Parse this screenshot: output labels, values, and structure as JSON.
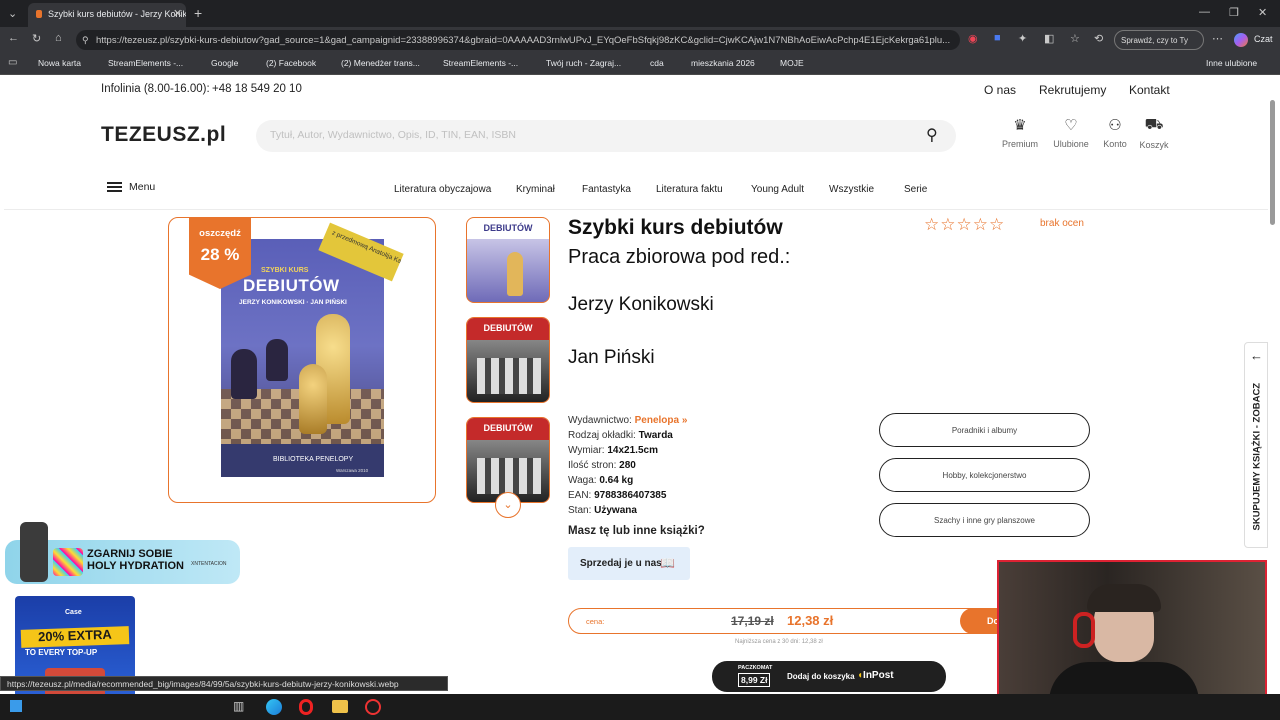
{
  "browser": {
    "tab_title": "Szybki kurs debiutów - Jerzy Konik...",
    "url": "https://tezeusz.pl/szybki-kurs-debiutow?gad_source=1&gad_campaignid=23388996374&gbraid=0AAAAAD3rnlwUPvJ_EYqOeFbSfqkj98zKC&gclid=CjwKCAjw1N7NBhAoEiwAcPchp4E1EjcKekrga61plu...",
    "profile_label": "Sprawdź, czy to Ty",
    "chat_label": "Czat",
    "bookmarks": [
      "Nowa karta",
      "StreamElements -...",
      "Google",
      "(2) Facebook",
      "(2) Menedżer trans...",
      "StreamElements -...",
      "Twój ruch - Zagraj...",
      "cda",
      "mieszkania 2026",
      "MOJE"
    ],
    "other_bookmarks": "Inne ulubione"
  },
  "topbar": {
    "hotline_label": "Infolinia (8.00-16.00):",
    "hotline_phone": "+48 18 549 20 10",
    "links": [
      "O nas",
      "Rekrutujemy",
      "Kontakt"
    ]
  },
  "header": {
    "logo": "TEZEUSZ.pl",
    "search_placeholder": "Tytuł, Autor, Wydawnictwo, Opis, ID, TIN, EAN, ISBN",
    "icons": [
      "Premium",
      "Ulubione",
      "Konto",
      "Koszyk"
    ]
  },
  "nav": {
    "menu_label": "Menu",
    "items": [
      "Literatura obyczajowa",
      "Kryminał",
      "Fantastyka",
      "Literatura faktu",
      "Young Adult",
      "Wszystkie",
      "Serie"
    ]
  },
  "product": {
    "discount_label": "oszczędź",
    "discount_value": "28 %",
    "cover_title": "DEBIUTÓW",
    "cover_small": "SZYBKI KURS",
    "cover_authors": "JERZY KONIKOWSKI · JAN PIŃSKI",
    "cover_ribbon": "z przedmową Anatolija Karpowa",
    "cover_series": "BIBLIOTEKA PENELOPY",
    "cover_place": "Warszawa 2010",
    "thumb_titles": [
      "DEBIUTÓW",
      "DEBIUTÓW",
      "DEBIUTÓW"
    ],
    "title": "Szybki kurs debiutów",
    "subtitle": "Praca zbiorowa pod red.:",
    "authors": [
      "Jerzy Konikowski",
      "Jan Piński"
    ],
    "rating_text": "brak ocen",
    "details": [
      {
        "label": "Wydawnictwo:",
        "value": "Penelopa »"
      },
      {
        "label": "Rodzaj okładki:",
        "value": "Twarda"
      },
      {
        "label": "Wymiar:",
        "value": "14x21.5cm"
      },
      {
        "label": "Ilość stron:",
        "value": "280"
      },
      {
        "label": "Waga:",
        "value": "0.64 kg"
      },
      {
        "label": "EAN:",
        "value": "9788386407385"
      },
      {
        "label": "Stan:",
        "value": "Używana"
      }
    ],
    "sell_question": "Masz tę lub inne książki?",
    "sell_button": "Sprzedaj je u nas",
    "categories": [
      "Poradniki i albumy",
      "Hobby, kolekcjonerstwo",
      "Szachy i inne gry planszowe"
    ],
    "price_label": "cena:",
    "old_price": "17,19 zł",
    "new_price": "12,38 zł",
    "add_partial": "Do",
    "lowest_price_note": "Najniższa cena z 30 dni: 12,38 zł",
    "paczkomat_label": "PACZKOMAT",
    "paczkomat_price": "8,99 Zł",
    "add_to_cart": "Dodaj do koszyka",
    "inpost": "InPost"
  },
  "side_tab": "SKUPUJEMY KSIĄŻKI - ZOBACZ",
  "ads": {
    "hydration": "ZGARNIJ SOBIE HOLY HYDRATION",
    "hydration_tag": "XNTENTACION",
    "casehug_brand": "Case",
    "casehug_promo": "20% EXTRA",
    "casehug_sub": "TO EVERY TOP-UP"
  },
  "status_url": "https://tezeusz.pl/media/recommended_big/images/84/99/5a/szybki-kurs-debiutw-jerzy-konikowski.webp",
  "colors": {
    "accent": "#e8742c",
    "dark": "#202020"
  }
}
